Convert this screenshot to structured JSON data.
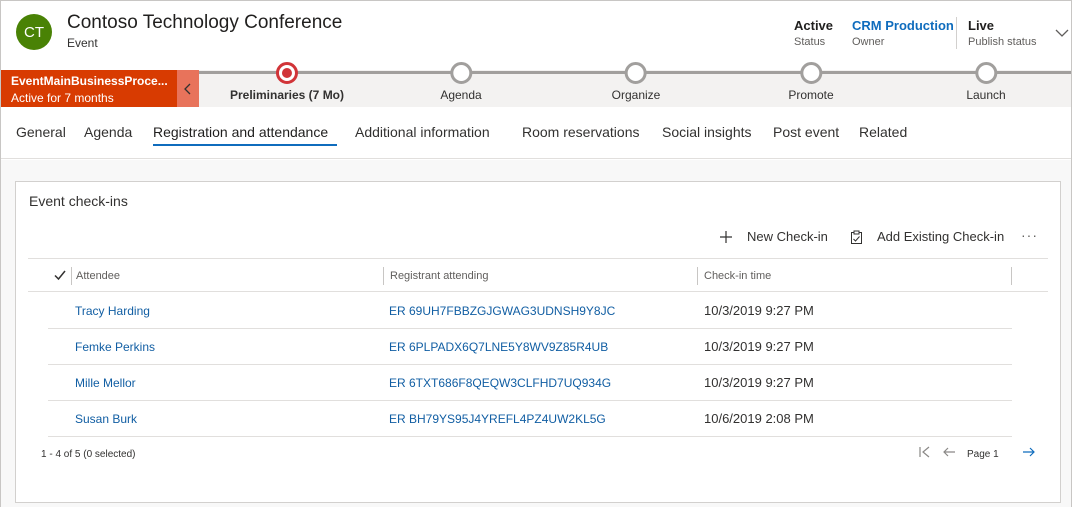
{
  "record": {
    "initials": "CT",
    "title": "Contoso Technology Conference",
    "entity": "Event"
  },
  "header_fields": [
    {
      "value": "Active",
      "label": "Status"
    },
    {
      "value": "CRM Production",
      "label": "Owner"
    },
    {
      "value": "Live",
      "label": "Publish status"
    }
  ],
  "bpf": {
    "process_name": "EventMainBusinessProce...",
    "duration": "Active for 7 months",
    "stages": [
      {
        "label": "Preliminaries  (7 Mo)",
        "active": true
      },
      {
        "label": "Agenda"
      },
      {
        "label": "Organize"
      },
      {
        "label": "Promote"
      },
      {
        "label": "Launch"
      }
    ]
  },
  "tabs": [
    "General",
    "Agenda",
    "Registration and attendance",
    "Additional information",
    "Room reservations",
    "Social insights",
    "Post event",
    "Related"
  ],
  "selected_tab": "Registration and attendance",
  "subgrid": {
    "title": "Event check-ins",
    "commands": {
      "new": "New Check-in",
      "add_existing": "Add Existing Check-in",
      "more": "···"
    },
    "columns": [
      "Attendee",
      "Registrant attending",
      "Check-in time"
    ],
    "rows": [
      {
        "attendee": "Tracy Harding",
        "registrant": "ER 69UH7FBBZGJGWAG3UDNSH9Y8JC",
        "time": "10/3/2019 9:27 PM"
      },
      {
        "attendee": "Femke Perkins",
        "registrant": "ER 6PLPADX6Q7LNE5Y8WV9Z85R4UB",
        "time": "10/3/2019 9:27 PM"
      },
      {
        "attendee": "Mille Mellor",
        "registrant": "ER 6TXT686F8QEQW3CLFHD7UQ934G",
        "time": "10/3/2019 9:27 PM"
      },
      {
        "attendee": "Susan Burk",
        "registrant": "ER BH79YS95J4YREFL4PZ4UW2KL5G",
        "time": "10/6/2019 2:08 PM"
      }
    ],
    "footer": "1 - 4 of 5 (0 selected)",
    "page_label": "Page 1"
  },
  "colors": {
    "avatar": "#498205",
    "bpf_flag": "#d83b01",
    "active_stage": "#d13438",
    "link": "#115ea3",
    "tab_underline": "#0f6cbd"
  }
}
